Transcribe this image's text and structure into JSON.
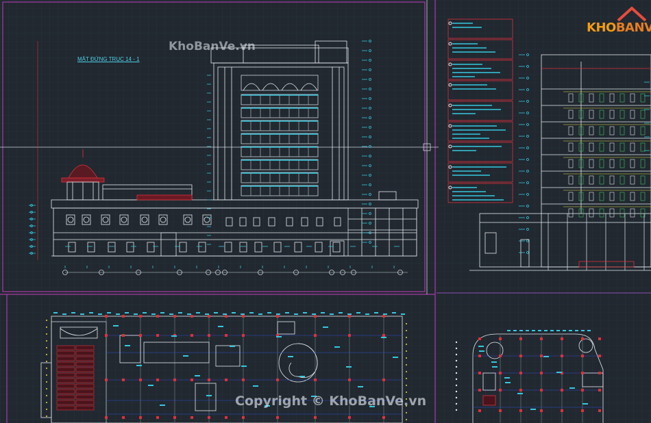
{
  "watermark_top": "KhoBanVe.vn",
  "watermark_bottom": "Copyright © KhoBanVe.vn",
  "logo": {
    "part1": "KHO",
    "part2": "BANVE"
  },
  "elevation_title": "MẶT ĐỨNG TRỤC 14 - 1",
  "colors": {
    "background": "#212830",
    "grid": "#2c3540",
    "frame": "#b03fb0",
    "linework": "#e8eef2",
    "cyan": "#35c9e0",
    "red": "#e0303a",
    "yellow": "#e8e040",
    "green": "#40c860",
    "blue": "#3050d0"
  }
}
